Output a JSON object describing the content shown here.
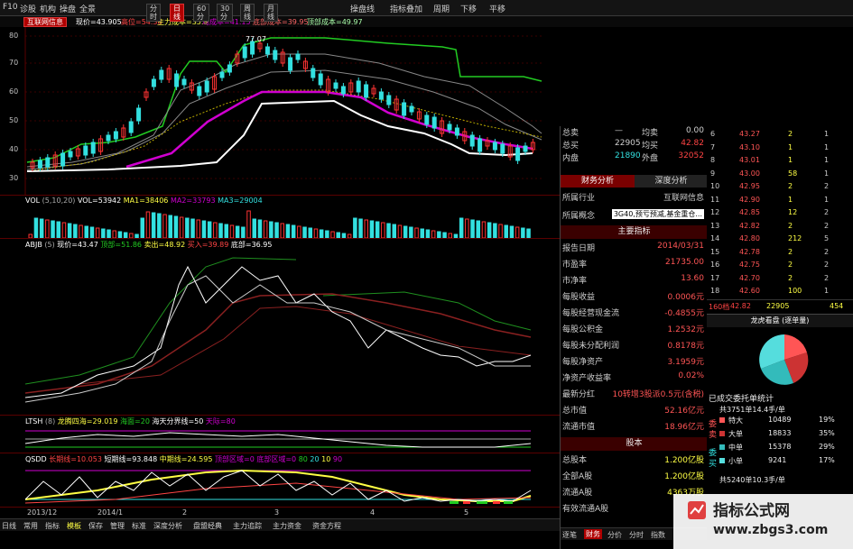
{
  "menu": {
    "items": [
      "F10",
      "诊股",
      "机构",
      "操盘",
      "全景"
    ],
    "right_items": [
      "操盘线",
      "指标叠加",
      "周期",
      "下移",
      "平移"
    ]
  },
  "toolbar": {
    "stock_name": "互联网信息",
    "price_info": "现价=43.905",
    "high": "高位=54.38",
    "main_cost": "主力成本=35.9",
    "avg_cost": "均成本=41.15",
    "bottom_cost": "底部成本=39.95",
    "resist_cost": "顶部成本=49.97",
    "periods": [
      "分时",
      "日线",
      "60分",
      "30分",
      "周线",
      "月线"
    ],
    "active_period": "日线"
  },
  "main_chart": {
    "y_ticks": [
      "80",
      "70",
      "60",
      "50",
      "40",
      "30"
    ],
    "peak_label": "77.07"
  },
  "vol_panel": {
    "label": "VOL",
    "params": "(5,10,20)",
    "vol": "VOL=53942",
    "ma1": "MA1=38406",
    "ma2": "MA2=33793",
    "ma3": "MA3=29004"
  },
  "abjb_panel": {
    "label": "ABJB",
    "params": "(5)",
    "current": "现价=43.47",
    "top": "顶部=51.86",
    "sell": "卖出=48.92",
    "buy": "买入=39.89",
    "bottom": "底部=36.95"
  },
  "ltsh_panel": {
    "label": "LTSH",
    "params": "(8)",
    "l1": "龙腾四海=29.019",
    "l2": "海面=20",
    "l3": "海天分界线=50",
    "l4": "天际=80"
  },
  "qsdd_panel": {
    "label": "QSDD",
    "l1": "长期线=10.053",
    "l2": "短期线=93.848",
    "l3": "中期线=24.595",
    "l4": "顶部区域=0",
    "l5": "底部区域=0",
    "l6": "80",
    "l7": "20",
    "l8": "10",
    "l9": "90"
  },
  "x_axis": {
    "labels": [
      "2013/12",
      "2014/1",
      "2",
      "3",
      "4",
      "5"
    ]
  },
  "bottom_tabs": [
    "日线",
    "常用",
    "指标",
    "模板",
    "保存",
    "管理",
    "标准",
    "深度分析",
    "盘盟经典",
    "主力追踪",
    "主力资金",
    "资金方程"
  ],
  "quote": {
    "rows": [
      {
        "k": "总卖",
        "v1": "—",
        "k2": "均卖",
        "v2": "0.00"
      },
      {
        "k": "总买",
        "v1": "22905",
        "k2": "均买",
        "v2": "42.82"
      },
      {
        "k": "内盘",
        "v1": "21890",
        "k2": "外盘",
        "v2": "32052"
      }
    ],
    "tabs": [
      "财务分析",
      "深度分析"
    ],
    "industry_label": "所属行业",
    "industry": "互联网信息",
    "concept_label": "所属概念",
    "concept": "3G40,预亏预减,基金重仓...",
    "main_indicator_header": "主要指标",
    "financials": [
      {
        "k": "报告日期",
        "v": "2014/03/31"
      },
      {
        "k": "市盈率",
        "v": "21735.00"
      },
      {
        "k": "市净率",
        "v": "13.60"
      },
      {
        "k": "每股收益",
        "v": "0.0006元"
      },
      {
        "k": "每股经营现金流",
        "v": "-0.4855元"
      },
      {
        "k": "每股公积金",
        "v": "1.2532元"
      },
      {
        "k": "每股未分配利润",
        "v": "0.8178元"
      },
      {
        "k": "每股净资产",
        "v": "3.1959元"
      },
      {
        "k": "净资产收益率",
        "v": "0.02%"
      },
      {
        "k": "最新分红",
        "v": "10转增3股派0.5元(含税)"
      },
      {
        "k": "总市值",
        "v": "52.16亿元"
      },
      {
        "k": "流通市值",
        "v": "18.96亿元"
      }
    ],
    "equity_header": "股本",
    "equity": [
      {
        "k": "总股本",
        "v": "1.200亿股"
      },
      {
        "k": "全部A股",
        "v": "1.200亿股"
      },
      {
        "k": "流通A股",
        "v": "4363万股"
      },
      {
        "k": "有效流通A股",
        "v": ""
      }
    ],
    "bottom_tabs": [
      "逐笔",
      "财务",
      "分价",
      "分时",
      "指数"
    ]
  },
  "orderbook": {
    "rows": [
      {
        "n": "6",
        "p": "43.27",
        "v": "2",
        "c": "1"
      },
      {
        "n": "7",
        "p": "43.10",
        "v": "1",
        "c": "1"
      },
      {
        "n": "8",
        "p": "43.01",
        "v": "1",
        "c": "1"
      },
      {
        "n": "9",
        "p": "43.00",
        "v": "58",
        "c": "1"
      },
      {
        "n": "10",
        "p": "42.95",
        "v": "2",
        "c": "2"
      },
      {
        "n": "11",
        "p": "42.90",
        "v": "1",
        "c": "1"
      },
      {
        "n": "12",
        "p": "42.85",
        "v": "12",
        "c": "2"
      },
      {
        "n": "13",
        "p": "42.82",
        "v": "2",
        "c": "2"
      },
      {
        "n": "14",
        "p": "42.80",
        "v": "212",
        "c": "5"
      },
      {
        "n": "15",
        "p": "42.78",
        "v": "2",
        "c": "2"
      },
      {
        "n": "16",
        "p": "42.75",
        "v": "2",
        "c": "2"
      },
      {
        "n": "17",
        "p": "42.70",
        "v": "2",
        "c": "2"
      },
      {
        "n": "18",
        "p": "42.60",
        "v": "100",
        "c": "1"
      }
    ],
    "footer_left": "160档",
    "footer_price": "42.82",
    "footer_vol": "22905",
    "footer_right": "454"
  },
  "dragon": {
    "title": "龙虎看盘 (逐单量)",
    "subtitle": "已成交委托单统计",
    "total_sell": "共3751单14.4手/单",
    "side_sell": "委卖",
    "side_buy": "委买",
    "rows": [
      {
        "k": "特大",
        "v": "10489",
        "p": "19%"
      },
      {
        "k": "大单",
        "v": "18833",
        "p": "35%"
      },
      {
        "k": "中单",
        "v": "15378",
        "p": "29%"
      },
      {
        "k": "小单",
        "v": "9241",
        "p": "17%"
      }
    ],
    "total_buy": "共5240单10.3手/单"
  },
  "watermark": {
    "title": "指标公式网",
    "url": "www.zbgs3.com"
  },
  "colors": {
    "up": "#ff3333",
    "down": "#33e0e0",
    "green_line": "#22cc22",
    "magenta": "#d000d0",
    "white": "#ffffff",
    "yellow": "#ffff44"
  }
}
